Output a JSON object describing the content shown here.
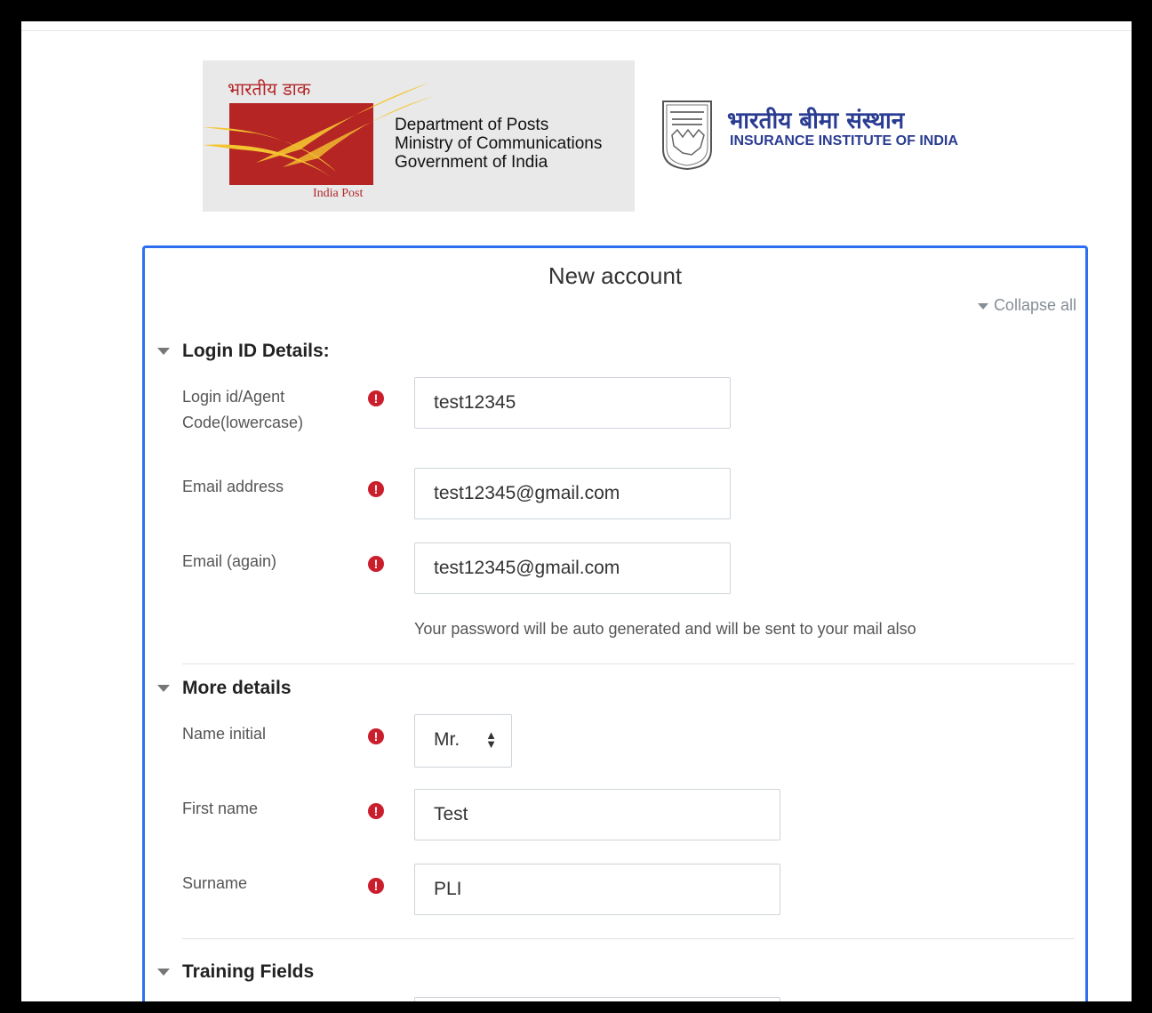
{
  "logos": {
    "india_post": {
      "hindi_name": "भारतीय डाक",
      "caption": "India Post",
      "lines": [
        "Department of Posts",
        "Ministry of Communications",
        "Government of India"
      ],
      "colors": {
        "red": "#b52524",
        "yellow": "#f4c430"
      }
    },
    "insurance_institute": {
      "hindi_name": "भारतीय बीमा संस्थान",
      "english_name": "INSURANCE INSTITUTE OF INDIA",
      "color": "#2a3c92"
    }
  },
  "form": {
    "title": "New account",
    "collapse_all_label": "Collapse all",
    "accent_color": "#2e6ff2",
    "required_icon": "exclamation-circle-icon",
    "sections": {
      "login": {
        "title": "Login ID Details:",
        "fields": {
          "login_id": {
            "label": "Login id/Agent Code(lowercase)",
            "value": "test12345"
          },
          "email": {
            "label": "Email address",
            "value": "test12345@gmail.com"
          },
          "email_again": {
            "label": "Email (again)",
            "value": "test12345@gmail.com"
          }
        },
        "password_note": "Your password will be auto generated and will be sent to your mail also"
      },
      "more": {
        "title": "More details",
        "fields": {
          "name_initial": {
            "label": "Name initial",
            "value": "Mr."
          },
          "first_name": {
            "label": "First name",
            "value": "Test"
          },
          "surname": {
            "label": "Surname",
            "value": "PLI"
          }
        }
      },
      "training": {
        "title": "Training Fields"
      }
    }
  }
}
